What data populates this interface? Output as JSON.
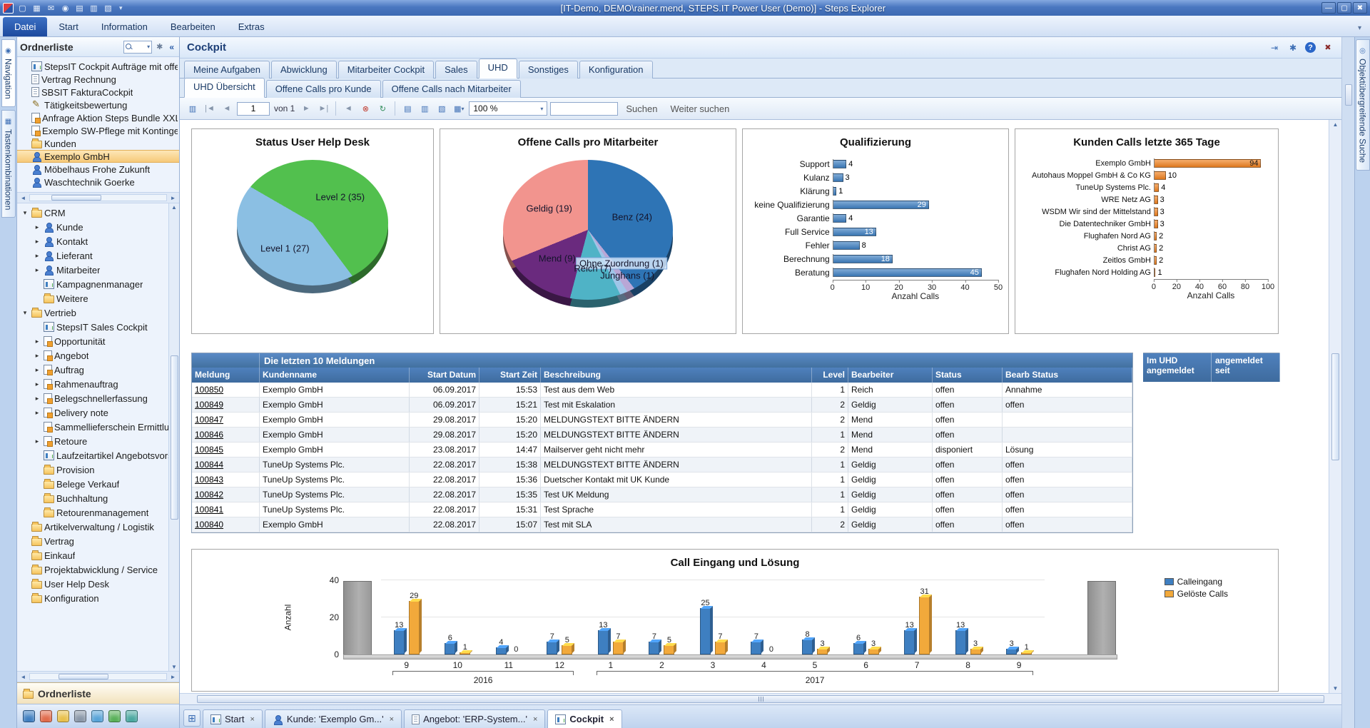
{
  "window": {
    "title": "[IT-Demo, DEMO\\rainer.mend, STEPS.IT Power User (Demo)] - Steps Explorer"
  },
  "titlebar": {
    "quick_icons": [
      "window",
      "save",
      "mail",
      "globe",
      "print",
      "print-preview",
      "page-setup"
    ]
  },
  "menubar": {
    "items": [
      "Datei",
      "Start",
      "Information",
      "Bearbeiten",
      "Extras"
    ],
    "active": "Datei"
  },
  "side_rails": {
    "left": [
      {
        "label": "Navigation",
        "icon": "compass",
        "active": true
      },
      {
        "label": "Tastenkombinationen",
        "icon": "keyboard",
        "active": false
      }
    ],
    "right": [
      {
        "label": "Objektübergreifende Suche",
        "icon": "magnifier",
        "active": false
      }
    ]
  },
  "folder_panel": {
    "title": "Ordnerliste",
    "footer_button": "Ordnerliste",
    "shortcuts": [
      {
        "label": "StepsIT Cockpit Aufträge mit offe",
        "icon": "report"
      },
      {
        "label": "Vertrag Rechnung",
        "icon": "doc"
      },
      {
        "label": "SBSIT FakturaCockpit",
        "icon": "doc"
      },
      {
        "label": "Tätigkeitsbewertung",
        "icon": "pencil"
      },
      {
        "label": "Anfrage Aktion Steps Bundle XXL",
        "icon": "form"
      },
      {
        "label": "Exemplo SW-Pflege mit Kontingent",
        "icon": "form"
      },
      {
        "label": "Kunden",
        "icon": "folder"
      },
      {
        "label": "Exemplo GmbH",
        "icon": "person",
        "selected": true
      },
      {
        "label": "Möbelhaus Frohe Zukunft",
        "icon": "person"
      },
      {
        "label": "Waschtechnik Goerke",
        "icon": "person"
      }
    ],
    "tree": [
      {
        "label": "CRM",
        "icon": "folder",
        "expand": "open",
        "level": 0
      },
      {
        "label": "Kunde",
        "icon": "person",
        "expand": "closed",
        "level": 1
      },
      {
        "label": "Kontakt",
        "icon": "person",
        "expand": "closed",
        "level": 1
      },
      {
        "label": "Lieferant",
        "icon": "person",
        "expand": "closed",
        "level": 1
      },
      {
        "label": "Mitarbeiter",
        "icon": "person",
        "expand": "closed",
        "level": 1
      },
      {
        "label": "Kampagnenmanager",
        "icon": "report",
        "level": 1
      },
      {
        "label": "Weitere",
        "icon": "folder",
        "level": 1
      },
      {
        "label": "Vertrieb",
        "icon": "folder",
        "expand": "open",
        "level": 0
      },
      {
        "label": "StepsIT Sales Cockpit",
        "icon": "report",
        "level": 1
      },
      {
        "label": "Opportunität",
        "icon": "form",
        "expand": "closed",
        "level": 1
      },
      {
        "label": "Angebot",
        "icon": "form",
        "expand": "closed",
        "level": 1
      },
      {
        "label": "Auftrag",
        "icon": "form",
        "expand": "closed",
        "level": 1
      },
      {
        "label": "Rahmenauftrag",
        "icon": "form",
        "expand": "closed",
        "level": 1
      },
      {
        "label": "Belegschnellerfassung",
        "icon": "form",
        "expand": "closed",
        "level": 1
      },
      {
        "label": "Delivery note",
        "icon": "form",
        "expand": "closed",
        "level": 1
      },
      {
        "label": "Sammellieferschein Ermittlung",
        "icon": "form",
        "level": 1
      },
      {
        "label": "Retoure",
        "icon": "form",
        "expand": "closed",
        "level": 1
      },
      {
        "label": "Laufzeitartikel Angebotsvorsc",
        "icon": "report",
        "level": 1
      },
      {
        "label": "Provision",
        "icon": "folder",
        "level": 1
      },
      {
        "label": "Belege Verkauf",
        "icon": "folder",
        "level": 1
      },
      {
        "label": "Buchhaltung",
        "icon": "folder",
        "level": 1
      },
      {
        "label": "Retourenmanagement",
        "icon": "folder",
        "level": 1
      },
      {
        "label": "Artikelverwaltung / Logistik",
        "icon": "folder",
        "level": 0
      },
      {
        "label": "Vertrag",
        "icon": "folder",
        "level": 0
      },
      {
        "label": "Einkauf",
        "icon": "folder",
        "level": 0
      },
      {
        "label": "Projektabwicklung / Service",
        "icon": "folder",
        "level": 0
      },
      {
        "label": "User Help Desk",
        "icon": "folder",
        "level": 0
      },
      {
        "label": "Konfiguration",
        "icon": "folder",
        "level": 0
      }
    ],
    "footer_icons": [
      {
        "name": "users-icon",
        "color": "#3f7fc1"
      },
      {
        "name": "calendar-icon",
        "color": "#e06a4a"
      },
      {
        "name": "notes-icon",
        "color": "#e8c04a"
      },
      {
        "name": "settings-icon",
        "color": "#8a97a8"
      },
      {
        "name": "mail-icon",
        "color": "#57a3d8"
      },
      {
        "name": "chart-icon",
        "color": "#58b058"
      },
      {
        "name": "monitor-icon",
        "color": "#4aa8a0"
      }
    ]
  },
  "cockpit": {
    "title": "Cockpit",
    "tabs": [
      "Meine Aufgaben",
      "Abwicklung",
      "Mitarbeiter Cockpit",
      "Sales",
      "UHD",
      "Sonstiges",
      "Konfiguration"
    ],
    "active_tab": "UHD",
    "subtabs": [
      "UHD Übersicht",
      "Offene Calls pro Kunde",
      "Offene Calls nach Mitarbeiter"
    ],
    "active_subtab": "UHD Übersicht",
    "toolbar": {
      "page_value": "1",
      "page_of_label": "von 1",
      "zoom_value": "100 %",
      "search_button": "Suchen",
      "search_next_button": "Weiter suchen"
    }
  },
  "chart_data": [
    {
      "type": "pie",
      "title": "Status User Help Desk",
      "start_angle": 300,
      "slices": [
        {
          "label": "Level 2 (35)",
          "value": 35,
          "color": "#52c04e"
        },
        {
          "label": "Level 1 (27)",
          "value": 27,
          "color": "#8bbfe3"
        }
      ]
    },
    {
      "type": "pie",
      "title": "Offene Calls pro Mitarbeiter",
      "start_angle": 0,
      "slices": [
        {
          "label": "Benz (24)",
          "value": 24,
          "color": "#2e74b5"
        },
        {
          "label": "Junghans (1)",
          "value": 1,
          "color": "#b9a7d6"
        },
        {
          "label": "Ohne Zuordnung (1)",
          "value": 1,
          "color": "#9fc5e8",
          "highlight": true
        },
        {
          "label": "Reich (7)",
          "value": 7,
          "color": "#4fb3c6"
        },
        {
          "label": "Mend (9)",
          "value": 9,
          "color": "#6a2a7e"
        },
        {
          "label": "Geldig (19)",
          "value": 19,
          "color": "#f2948e"
        }
      ]
    },
    {
      "type": "bar",
      "orientation": "horizontal",
      "title": "Qualifizierung",
      "categories": [
        "Support",
        "Kulanz",
        "Klärung",
        "keine Qualifizierung",
        "Garantie",
        "Full Service",
        "Fehler",
        "Berechnung",
        "Beratung"
      ],
      "values": [
        4,
        3,
        1,
        29,
        4,
        13,
        8,
        18,
        45
      ],
      "bar_color": "#3e7fc1",
      "xlabel": "Anzahl Calls",
      "ticks": [
        0,
        10,
        20,
        30,
        40,
        50
      ],
      "xmax": 50
    },
    {
      "type": "bar",
      "orientation": "horizontal",
      "title": "Kunden Calls letzte 365 Tage",
      "categories": [
        "Exemplo GmbH",
        "Autohaus Moppel GmbH & Co KG",
        "TuneUp Systems Plc.",
        "WRE Netz AG",
        "WSDM Wir sind der Mittelstand",
        "Die Datentechniker GmbH",
        "Flughafen Nord AG",
        "Christ AG",
        "Zeitlos GmbH",
        "Flughafen Nord Holding AG"
      ],
      "values": [
        94,
        10,
        4,
        3,
        3,
        3,
        2,
        2,
        2,
        1
      ],
      "bar_color": "#f08220",
      "xlabel": "Anzahl Calls",
      "ticks": [
        0,
        20,
        40,
        60,
        80,
        100
      ],
      "xmax": 100
    },
    {
      "type": "bar",
      "orientation": "vertical",
      "title": "Call Eingang und Lösung",
      "categories": [
        "9",
        "10",
        "11",
        "12",
        "1",
        "2",
        "3",
        "4",
        "5",
        "6",
        "7",
        "8",
        "9"
      ],
      "year_groups": [
        {
          "label": "2016",
          "span": 4
        },
        {
          "label": "2017",
          "span": 9
        }
      ],
      "series": [
        {
          "name": "Calleingang",
          "color": "#3e7fc1",
          "values": [
            13,
            6,
            4,
            7,
            13,
            7,
            25,
            7,
            8,
            6,
            13,
            13,
            3
          ]
        },
        {
          "name": "Gelöste Calls",
          "color": "#f2a93b",
          "values": [
            29,
            1,
            0,
            5,
            7,
            5,
            7,
            0,
            3,
            3,
            31,
            3,
            1
          ]
        }
      ],
      "ylabel": "Anzahl",
      "yticks": [
        0,
        20,
        40
      ],
      "ymax": 40
    }
  ],
  "messages_table": {
    "band_title": "Die letzten 10 Meldungen",
    "columns": [
      "Meldung",
      "Kundenname",
      "Start Datum",
      "Start Zeit",
      "Beschreibung",
      "Level",
      "Bearbeiter",
      "Status",
      "Bearb Status"
    ],
    "rows": [
      [
        "100850",
        "Exemplo GmbH",
        "06.09.2017",
        "15:53",
        "Test aus dem Web",
        "1",
        "Reich",
        "offen",
        "Annahme"
      ],
      [
        "100849",
        "Exemplo GmbH",
        "06.09.2017",
        "15:21",
        "Test mit Eskalation",
        "2",
        "Geldig",
        "offen",
        "offen"
      ],
      [
        "100847",
        "Exemplo GmbH",
        "29.08.2017",
        "15:20",
        "MELDUNGSTEXT BITTE ÄNDERN",
        "2",
        "Mend",
        "offen",
        ""
      ],
      [
        "100846",
        "Exemplo GmbH",
        "29.08.2017",
        "15:20",
        "MELDUNGSTEXT BITTE ÄNDERN",
        "1",
        "Mend",
        "offen",
        ""
      ],
      [
        "100845",
        "Exemplo GmbH",
        "23.08.2017",
        "14:47",
        "Mailserver geht nicht mehr",
        "2",
        "Mend",
        "disponiert",
        "Lösung"
      ],
      [
        "100844",
        "TuneUp Systems Plc.",
        "22.08.2017",
        "15:38",
        "MELDUNGSTEXT BITTE ÄNDERN",
        "1",
        "Geldig",
        "offen",
        "offen"
      ],
      [
        "100843",
        "TuneUp Systems Plc.",
        "22.08.2017",
        "15:36",
        "Duetscher Kontakt mit UK Kunde",
        "1",
        "Geldig",
        "offen",
        "offen"
      ],
      [
        "100842",
        "TuneUp Systems Plc.",
        "22.08.2017",
        "15:35",
        "Test UK Meldung",
        "1",
        "Geldig",
        "offen",
        "offen"
      ],
      [
        "100841",
        "TuneUp Systems Plc.",
        "22.08.2017",
        "15:31",
        "Test Sprache",
        "1",
        "Geldig",
        "offen",
        "offen"
      ],
      [
        "100840",
        "Exemplo GmbH",
        "22.08.2017",
        "15:07",
        "Test mit SLA",
        "2",
        "Geldig",
        "offen",
        "offen"
      ]
    ]
  },
  "uhd_table": {
    "col1": "Im UHD angemeldet",
    "col2": "angemeldet seit"
  },
  "taskbar": {
    "tabs": [
      {
        "label": "Start",
        "icon": "report"
      },
      {
        "label": "Kunde: 'Exemplo Gm...'",
        "icon": "person"
      },
      {
        "label": "Angebot: 'ERP-System...'",
        "icon": "doc"
      },
      {
        "label": "Cockpit",
        "icon": "chart",
        "active": true
      }
    ]
  },
  "icon_glyphs": {
    "window": "▢",
    "save": "▦",
    "mail": "✉",
    "globe": "◉",
    "print": "▤",
    "print-preview": "▥",
    "page-setup": "▧",
    "dropdown": "▾",
    "minimize": "—",
    "maximize": "▢",
    "close": "✖",
    "first": "|◄",
    "prev": "◄",
    "next": "►",
    "last": "►|",
    "back": "◄",
    "cancel": "⊗",
    "refresh": "↻",
    "export": "▼",
    "collapse-left": "«",
    "tools": "✱",
    "expand-open": "▾",
    "expand-closed": "▸",
    "scroll-left": "◄",
    "scroll-right": "►",
    "scroll-up": "▲",
    "scroll-down": "▼",
    "help": "?",
    "pin": "⇥",
    "grid": "⊞",
    "tab-close": "×",
    "compass": "◉",
    "keyboard": "▦",
    "magnifier": "◎"
  }
}
